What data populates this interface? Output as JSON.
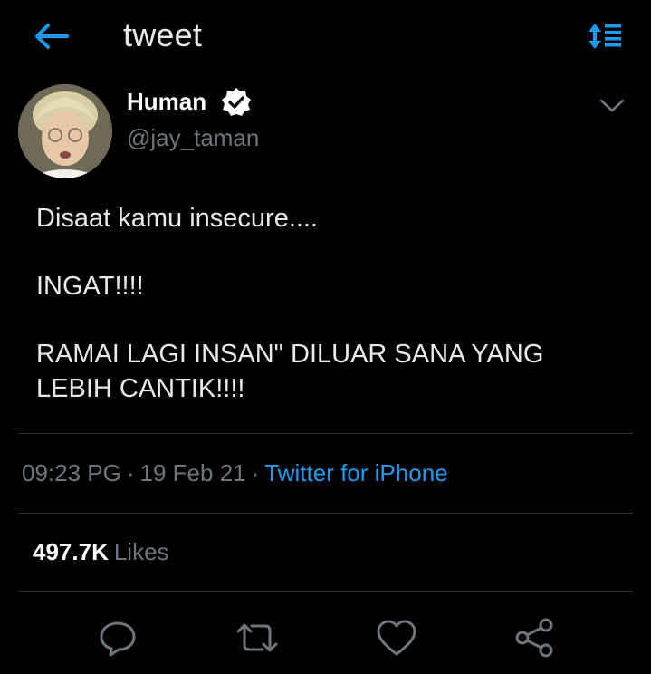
{
  "header": {
    "title": "tweet",
    "back_icon": "arrow-left-icon",
    "sort_icon": "sort-list-icon"
  },
  "tweet": {
    "author": {
      "display_name": "Human",
      "handle": "@jay_taman",
      "verified": true,
      "avatar_icon": "user-avatar"
    },
    "body_lines": [
      "Disaat kamu insecure....",
      "INGAT!!!!",
      "RAMAI LAGI INSAN\" DILUAR SANA YANG LEBIH CANTIK!!!!"
    ],
    "time": "09:23 PG",
    "separator": "·",
    "date": "19 Feb 21",
    "source": "Twitter for iPhone",
    "likes_count": "497.7K",
    "likes_label": "Likes"
  },
  "actions": [
    {
      "name": "reply",
      "icon": "reply-icon"
    },
    {
      "name": "retweet",
      "icon": "retweet-icon"
    },
    {
      "name": "like",
      "icon": "heart-icon"
    },
    {
      "name": "share",
      "icon": "share-icon"
    }
  ],
  "colors": {
    "background": "#000000",
    "accent": "#1d9bf0",
    "text": "#e7e9ea",
    "secondary_text": "#6e767d",
    "divider": "#2f3336"
  }
}
